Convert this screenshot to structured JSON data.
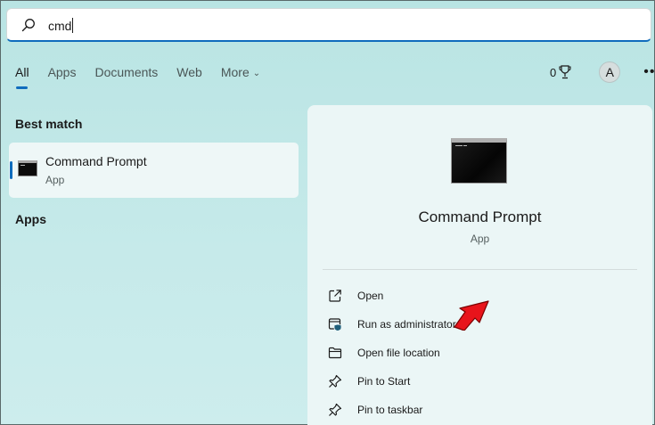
{
  "search": {
    "query": "cmd"
  },
  "tabs": [
    {
      "label": "All"
    },
    {
      "label": "Apps"
    },
    {
      "label": "Documents"
    },
    {
      "label": "Web"
    },
    {
      "label": "More"
    }
  ],
  "header": {
    "points": "0",
    "avatar_initial": "A"
  },
  "left": {
    "best_match_title": "Best match",
    "best_match": {
      "name": "Command Prompt",
      "type": "App"
    },
    "apps_title": "Apps"
  },
  "detail": {
    "name": "Command Prompt",
    "type": "App",
    "actions": [
      {
        "label": "Open",
        "icon": "open-external-icon"
      },
      {
        "label": "Run as administrator",
        "icon": "shield-window-icon"
      },
      {
        "label": "Open file location",
        "icon": "folder-icon"
      },
      {
        "label": "Pin to Start",
        "icon": "pin-icon"
      },
      {
        "label": "Pin to taskbar",
        "icon": "pin-icon"
      }
    ]
  },
  "colors": {
    "accent": "#0f6cbd",
    "annotation": "#e8141b"
  }
}
